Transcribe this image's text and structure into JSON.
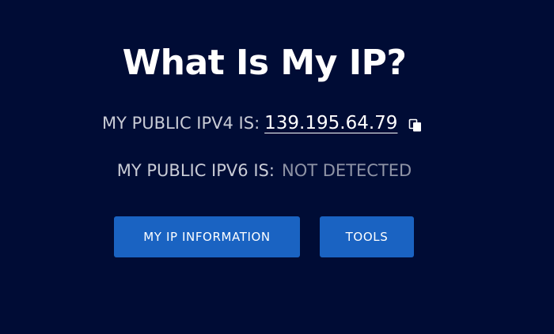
{
  "page": {
    "title": "What Is My IP?",
    "background_color": "#000c35"
  },
  "ipv4": {
    "label": "MY PUBLIC IPV4 IS:",
    "value": "139.195.64.79",
    "copy_icon": "copy-icon"
  },
  "ipv6": {
    "label": "MY PUBLIC IPV6 IS:",
    "value": "NOT DETECTED"
  },
  "buttons": {
    "info_label": "MY IP INFORMATION",
    "tools_label": "TOOLS",
    "color": "#1a63c2"
  }
}
